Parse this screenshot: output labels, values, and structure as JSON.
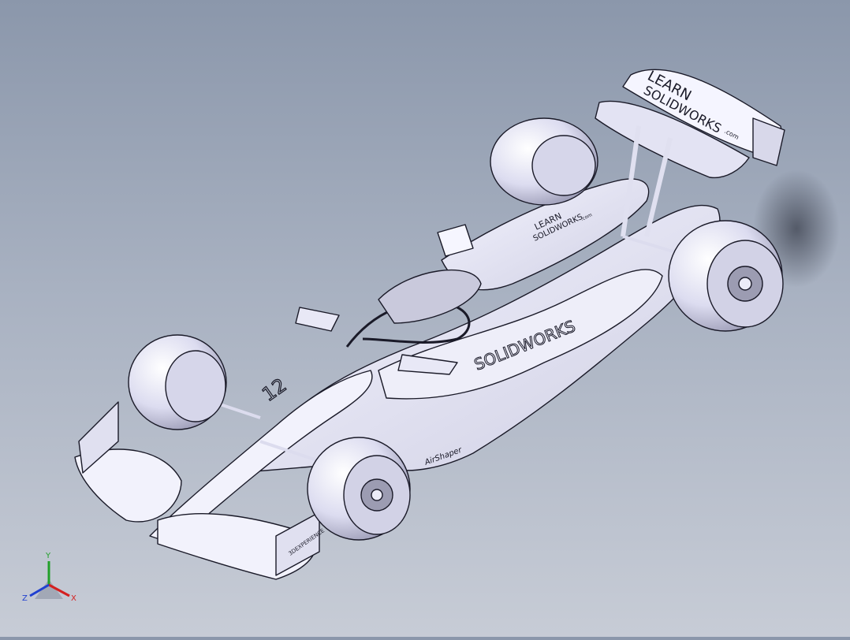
{
  "viewport": {
    "model": {
      "wing_logo_line1": "LEARN",
      "wing_logo_line2": "SOLIDWORKS",
      "wing_logo_suffix": ".com",
      "engine_cover_line1": "LEARN",
      "engine_cover_line2": "SOLIDWORKS",
      "engine_cover_suffix": ".com",
      "sidepod_text": "SOLIDWORKS",
      "car_number": "12",
      "floor_text": "AirShaper",
      "front_wing_text": "3DEXPERIENCE"
    },
    "triad": {
      "x_label": "X",
      "y_label": "Y",
      "z_label": "Z",
      "x_color": "#d42020",
      "y_color": "#22a02a",
      "z_color": "#2040d0"
    },
    "colors": {
      "background_top": "#8b97ab",
      "background_bottom": "#c7ccd6",
      "model_fill": "#e8e8f6",
      "model_edge": "#1a1a28"
    }
  }
}
